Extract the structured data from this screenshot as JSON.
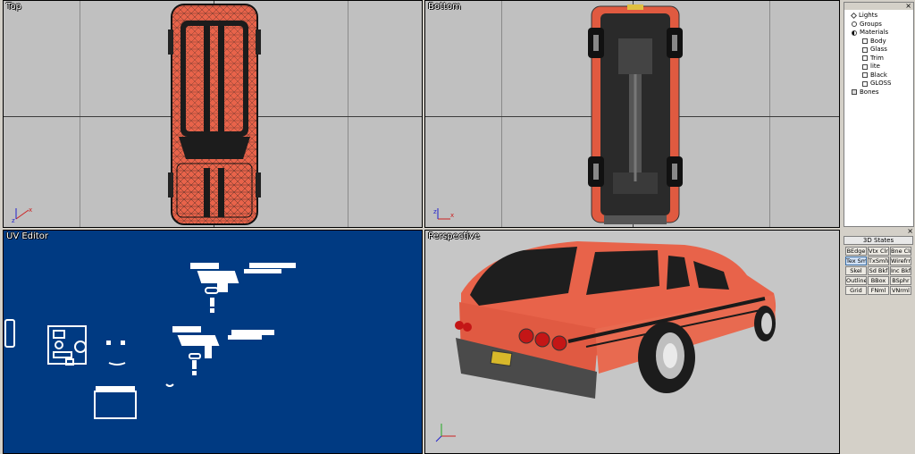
{
  "viewports": {
    "top": {
      "label": "Top"
    },
    "bottom": {
      "label": "Bottom"
    },
    "uv": {
      "label": "UV Editor"
    },
    "perspective": {
      "label": "Perspective"
    }
  },
  "scene_tree": {
    "close": "×",
    "items": [
      {
        "label": "Lights",
        "icon": "light-icon"
      },
      {
        "label": "Groups",
        "icon": "group-icon"
      },
      {
        "label": "Materials",
        "icon": "materials-icon"
      },
      {
        "label": "Body",
        "icon": "material-icon"
      },
      {
        "label": "Glass",
        "icon": "material-icon"
      },
      {
        "label": "Trim",
        "icon": "material-icon"
      },
      {
        "label": "lite",
        "icon": "material-icon"
      },
      {
        "label": "Black",
        "icon": "material-icon"
      },
      {
        "label": "GLOSS",
        "icon": "material-icon"
      },
      {
        "label": "Bones",
        "icon": "bones-icon"
      }
    ]
  },
  "states": {
    "title": "3D States",
    "close": "×",
    "buttons": [
      "BEdge",
      "Vtx Clr",
      "Bne Clr",
      "Tex Smi",
      "TxSmlWr",
      "Wirefrme",
      "Skel",
      "Sd Bkf",
      "Inc Bkf",
      "Outline",
      "BBox",
      "BSphr",
      "Grid",
      "FNml",
      "VNrml"
    ]
  },
  "colors": {
    "car_body": "#e8634a",
    "car_wire": "#1a1a1a",
    "uv_background": "#003a82",
    "viewport_gray": "#c0c0c0"
  }
}
